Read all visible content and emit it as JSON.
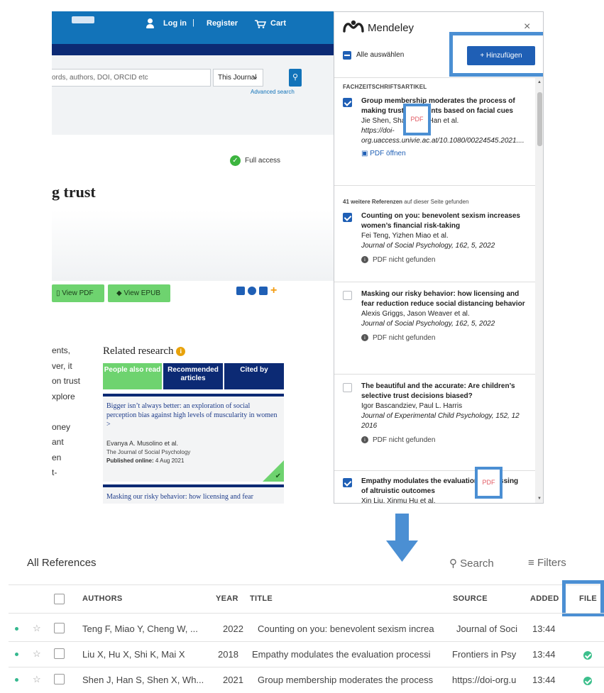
{
  "journal_page": {
    "header": {
      "login": "Log in",
      "separator": "|",
      "register": "Register",
      "cart": "Cart"
    },
    "search": {
      "placeholder": "ords, authors, DOI, ORCID etc",
      "scope": "This Journal",
      "advanced": "Advanced search"
    },
    "access": "Full access",
    "title_fragment": "g trust",
    "buttons": {
      "view_pdf": "View PDF",
      "view_epub": "View EPUB"
    },
    "left_text_fragments": [
      "ents,",
      "ver, it",
      "on trust",
      "xplore",
      "",
      "oney",
      "ant",
      "en",
      "t-"
    ],
    "related": {
      "title": "Related research",
      "info_glyph": "i",
      "tabs": [
        {
          "label": "People also read"
        },
        {
          "label": "Recommended articles"
        },
        {
          "label": "Cited by"
        }
      ],
      "cards": [
        {
          "title": "Bigger isn’t always better: an exploration of social perception bias against high levels of muscularity in women",
          "chevron": ">",
          "authors": "Evanya A. Musolino et al.",
          "journal": "The Journal of Social Psychology",
          "published_label": "Published online:",
          "published_date": "4 Aug 2021"
        },
        {
          "title": "Masking our risky behavior: how licensing and fear"
        }
      ]
    }
  },
  "mendeley": {
    "title": "Mendeley",
    "close": "×",
    "select_all": "Alle auswählen",
    "add_button": "+ Hinzufügen",
    "section_label": "FACHZEITSCHRIFTSARTIKEL",
    "pdf_badge": "PDF",
    "more_count": "41 weitere Referenzen",
    "more_suffix": " auf dieser Seite gefunden",
    "items": [
      {
        "title": "Group membership moderates the process of making trust judgments based on facial cues",
        "authors": "Jie Shen, Shangwen Han et al.",
        "url": "https://doi-org.uaccess.univie.ac.at/10.1080/00224545.2021....",
        "pdf_status": "PDF öffnen",
        "checked": true
      },
      {
        "title": "Counting on you: benevolent sexism increases women’s financial risk-taking",
        "authors": "Fei Teng, Yizhen Miao et al.",
        "journal": "Journal of Social Psychology, 162, 5, 2022",
        "pdf_status": "PDF nicht gefunden",
        "checked": true
      },
      {
        "title": "Masking our risky behavior: how licensing and fear reduction reduce social distancing behavior",
        "authors": "Alexis Griggs, Jason Weaver et al.",
        "journal": "Journal of Social Psychology, 162, 5, 2022",
        "pdf_status": "PDF nicht gefunden",
        "checked": false
      },
      {
        "title": "The beautiful and the accurate: Are children’s selective trust decisions biased?",
        "authors": "Igor Bascandziev, Paul L. Harris",
        "journal": "Journal of Experimental Child Psychology, 152, 12 2016",
        "pdf_status": "PDF nicht gefunden",
        "checked": false
      },
      {
        "title": "Empathy modulates the evaluation processing of altruistic outcomes",
        "authors": "Xin Liu, Xinmu Hu et al.",
        "checked": true
      }
    ]
  },
  "references": {
    "title": "All References",
    "search": "Search",
    "filters": "Filters",
    "columns": {
      "authors": "AUTHORS",
      "year": "YEAR",
      "title": "TITLE",
      "source": "SOURCE",
      "added": "ADDED",
      "file": "FILE"
    },
    "rows": [
      {
        "authors": "Teng F, Miao Y, Cheng W, ...",
        "year": "2022",
        "title": "Counting on you: benevolent sexism increa",
        "source": "Journal of Soci",
        "added": "13:44",
        "has_file": false
      },
      {
        "authors": "Liu X, Hu X, Shi K, Mai X",
        "year": "2018",
        "title": "Empathy modulates the evaluation processi",
        "source": "Frontiers in Psy",
        "added": "13:44",
        "has_file": true
      },
      {
        "authors": "Shen J, Han S, Shen X, Wh...",
        "year": "2021",
        "title": "Group membership moderates the process",
        "source": "https://doi-org.u",
        "added": "13:44",
        "has_file": true
      }
    ]
  },
  "colors": {
    "journal_blue": "#1273b9",
    "journal_navy": "#0c2a74",
    "journal_green": "#6ed36f",
    "mendeley_blue": "#1f5fb5",
    "highlight_blue": "#4b8fd3",
    "file_ok_green": "#3cbf8c"
  }
}
